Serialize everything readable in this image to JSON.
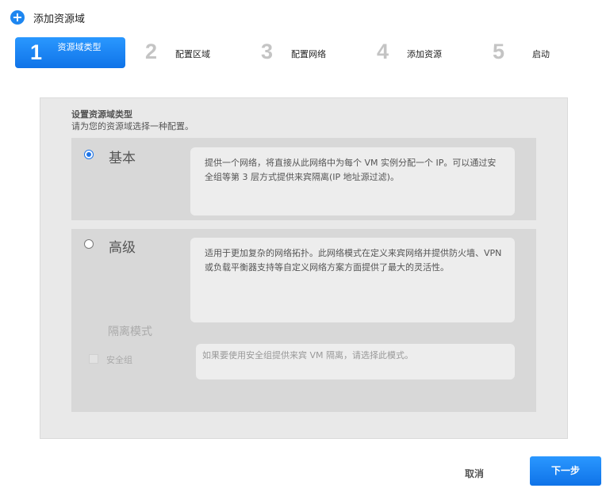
{
  "header": {
    "icon": "plus-circle-icon",
    "title": "添加资源域"
  },
  "steps": [
    {
      "num": "1",
      "label": "资源域类型",
      "active": true
    },
    {
      "num": "2",
      "label": "配置区域"
    },
    {
      "num": "3",
      "label": "配置网络"
    },
    {
      "num": "4",
      "label": "添加资源"
    },
    {
      "num": "5",
      "label": "启动"
    }
  ],
  "panel": {
    "title": "设置资源域类型",
    "subtitle": "请为您的资源域选择一种配置。",
    "options": {
      "basic": {
        "label": "基本",
        "selected": true,
        "description": "提供一个网络，将直接从此网络中为每个 VM 实例分配一个 IP。可以通过安全组等第 3 层方式提供来宾隔离(IP 地址源过滤)。"
      },
      "advanced": {
        "label": "高级",
        "selected": false,
        "description": "适用于更加复杂的网络拓扑。此网络模式在定义来宾网络并提供防火墙、VPN 或负载平衡器支持等自定义网络方案方面提供了最大的灵活性。",
        "isolation": {
          "heading": "隔离模式",
          "security_group_label": "安全组",
          "security_group_checked": false,
          "security_group_description": "如果要使用安全组提供来宾 VM 隔离，请选择此模式。"
        }
      }
    }
  },
  "footer": {
    "cancel_label": "取消",
    "next_label": "下一步"
  },
  "colors": {
    "accent": "#1d86f0",
    "panel_bg": "#e9e9e9",
    "option_bg": "#d8d8d8"
  }
}
